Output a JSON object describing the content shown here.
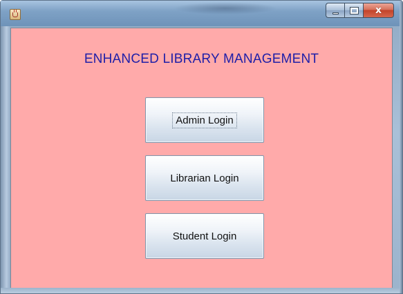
{
  "window": {
    "icon": "java-cup-icon",
    "caption_buttons": [
      "minimize-icon",
      "maximize-icon",
      "close-icon"
    ],
    "close_glyph": "x"
  },
  "main": {
    "heading": "ENHANCED LIBRARY MANAGEMENT",
    "background_color": "#ffaaaa",
    "heading_color": "#1e1ea8",
    "buttons": [
      {
        "label": "Admin Login",
        "focused": true
      },
      {
        "label": "Librarian Login",
        "focused": false
      },
      {
        "label": "Student Login",
        "focused": false
      }
    ]
  }
}
